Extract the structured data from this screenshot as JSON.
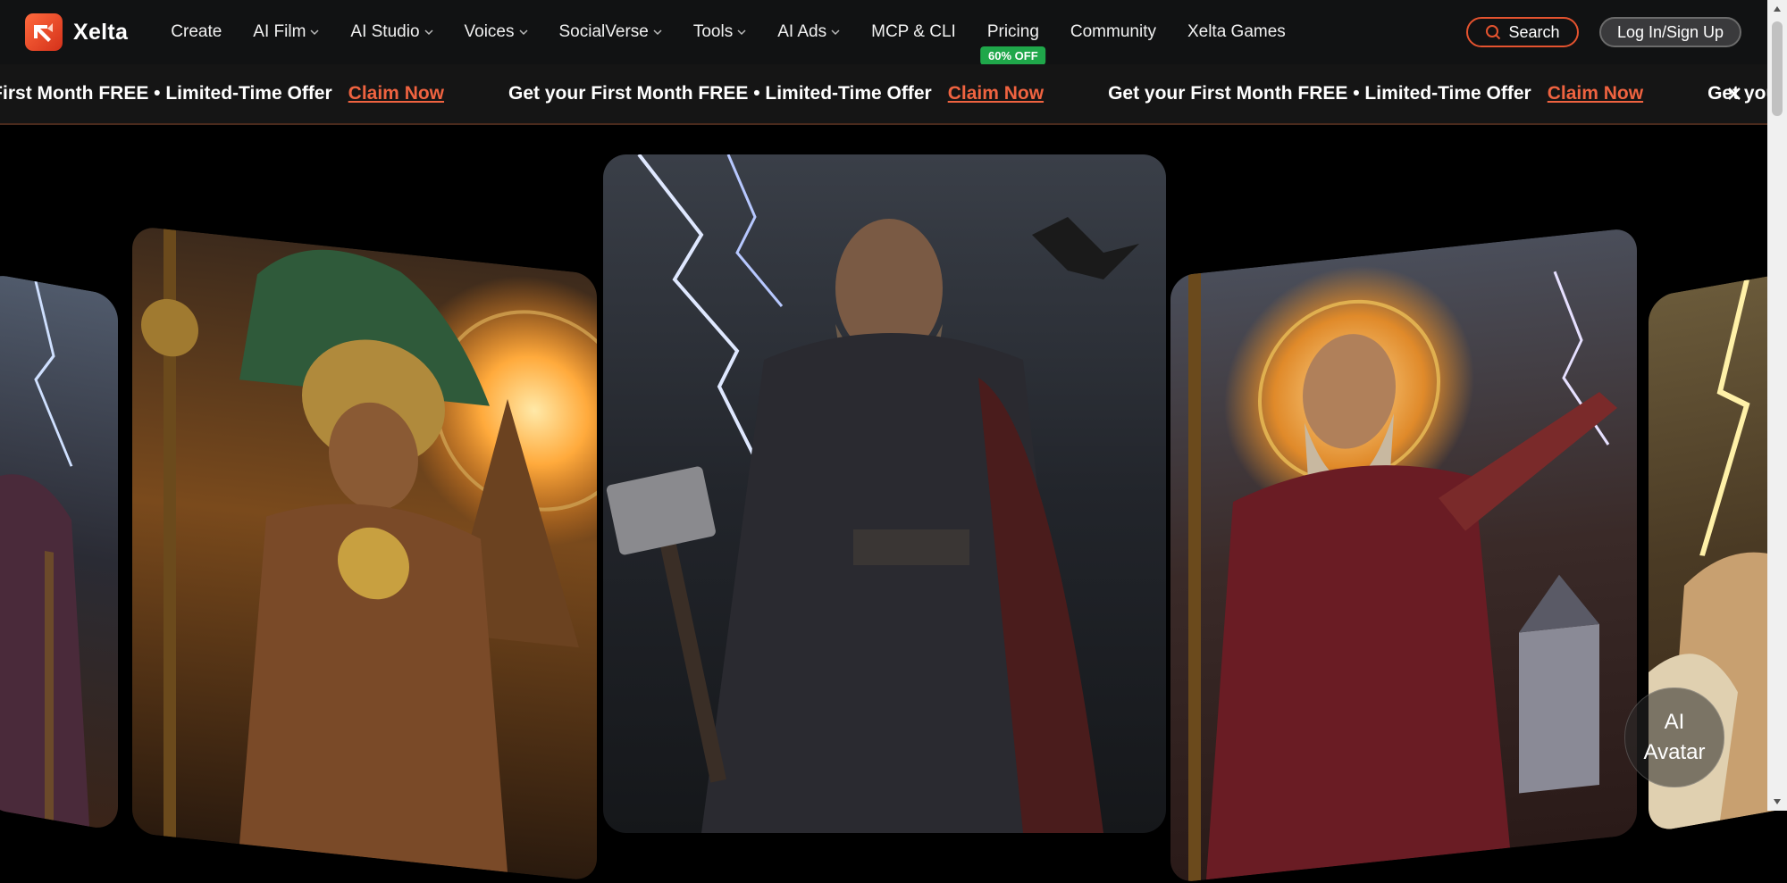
{
  "brand": {
    "name": "Xelta",
    "accent": "#e5532f"
  },
  "nav": {
    "items": [
      {
        "label": "Create",
        "dropdown": false
      },
      {
        "label": "AI Film",
        "dropdown": true
      },
      {
        "label": "AI Studio",
        "dropdown": true
      },
      {
        "label": "Voices",
        "dropdown": true
      },
      {
        "label": "SocialVerse",
        "dropdown": true
      },
      {
        "label": "Tools",
        "dropdown": true
      },
      {
        "label": "AI Ads",
        "dropdown": true
      },
      {
        "label": "MCP & CLI",
        "dropdown": false
      },
      {
        "label": "Pricing",
        "dropdown": false,
        "badge": "60% OFF"
      },
      {
        "label": "Community",
        "dropdown": false
      },
      {
        "label": "Xelta Games",
        "dropdown": false
      }
    ],
    "search_label": "Search",
    "login_label": "Log In/Sign Up"
  },
  "promo": {
    "text": "Get your First Month FREE • Limited-Time Offer",
    "link": "Claim Now",
    "close_icon": "close-icon"
  },
  "carousel": {
    "cards": [
      {
        "name": "storm-sorcerer-card",
        "theme": "storm"
      },
      {
        "name": "aztec-warrior-card",
        "theme": "golden-temple"
      },
      {
        "name": "thunder-god-card",
        "theme": "lightning-hammer"
      },
      {
        "name": "bearded-sage-card",
        "theme": "sun-halo"
      },
      {
        "name": "lightning-deity-card",
        "theme": "golden-lightning"
      }
    ]
  },
  "avatar_widget": {
    "line1": "AI",
    "line2": "Avatar"
  }
}
